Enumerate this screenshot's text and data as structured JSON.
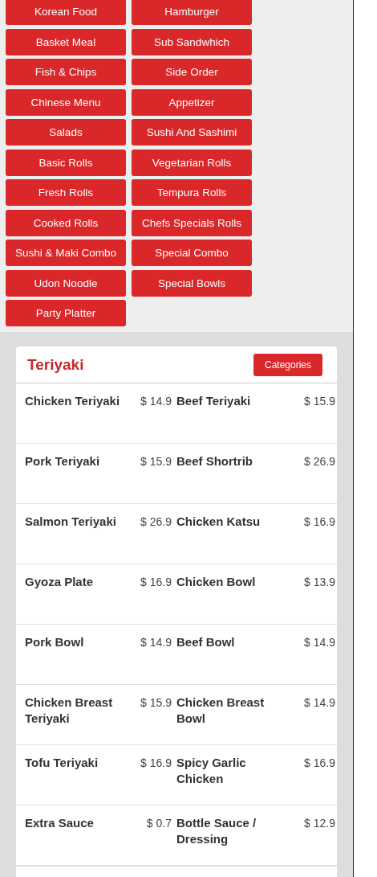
{
  "categories": [
    "Korean Food",
    "Hamburger",
    "Basket Meal",
    "Sub Sandwhich",
    "Fish & Chips",
    "Side Order",
    "Chinese Menu",
    "Appetizer",
    "Salads",
    "Sushi And Sashimi",
    "Basic Rolls",
    "Vegetarian Rolls",
    "Fresh Rolls",
    "Tempura Rolls",
    "Cooked Rolls",
    "Chefs Specials Rolls",
    "Sushi & Maki Combo",
    "Special Combo",
    "Udon Noodle",
    "Special Bowls",
    "Party Platter"
  ],
  "section": {
    "title": "Teriyaki",
    "button": "Categories",
    "items": [
      {
        "name": "Chicken Teriyaki",
        "price": "$ 14.9"
      },
      {
        "name": "Beef Teriyaki",
        "price": "$ 15.9"
      },
      {
        "name": "Pork Teriyaki",
        "price": "$ 15.9"
      },
      {
        "name": "Beef Shortrib",
        "price": "$ 26.9"
      },
      {
        "name": "Salmon Teriyaki",
        "price": "$ 26.9"
      },
      {
        "name": "Chicken Katsu",
        "price": "$ 16.9"
      },
      {
        "name": "Gyoza Plate",
        "price": "$ 16.9"
      },
      {
        "name": "Chicken Bowl",
        "price": "$ 13.9"
      },
      {
        "name": "Pork Bowl",
        "price": "$ 14.9"
      },
      {
        "name": "Beef Bowl",
        "price": "$ 14.9"
      },
      {
        "name": "Chicken Breast Teriyaki",
        "price": "$ 15.9"
      },
      {
        "name": "Chicken Breast Bowl",
        "price": "$ 14.9"
      },
      {
        "name": "Tofu Teriyaki",
        "price": "$ 16.9"
      },
      {
        "name": "Spicy Garlic Chicken",
        "price": "$ 16.9"
      },
      {
        "name": "Extra Sauce",
        "price": "$ 0.7"
      },
      {
        "name": "Bottle Sauce / Dressing",
        "price": "$ 12.9"
      }
    ]
  }
}
